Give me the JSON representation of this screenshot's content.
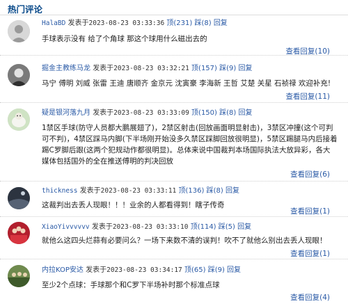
{
  "header": {
    "title": "热门评论"
  },
  "labels": {
    "posted": "发表于",
    "up": "顶",
    "down": "踩",
    "reply": "回复"
  },
  "comments": [
    {
      "user": "HalaBD",
      "time": "2023-08-23 03:33:36",
      "up": "(231)",
      "down": "(8)",
      "text": "手球表示没有 给了个角球 那这个球用什么磁出去的",
      "more": "查看回复(10)",
      "avatar_icon": "user-avatar-grey"
    },
    {
      "user": "掘金主教练马龙",
      "time": "2023-08-23 03:32:21",
      "up": "(157)",
      "down": "(9)",
      "text": "马宁 傅明 刘威 张雷 王迪 唐顺齐 金京元 沈寅豪 李海新 王哲 艾楚 关星 石祯禄 欢迎补充!",
      "more": "查看回复(11)",
      "avatar_icon": "user-avatar-photo"
    },
    {
      "user": "疑是银河落九月",
      "time": "2023-08-23 03:33:09",
      "up": "(150)",
      "down": "(8)",
      "text": "1禁区手球(防守人员都大鹏展翅了)，2禁区射击(回放画面明显射击)，3禁区冲撞(这个可判可不判)，4禁区踩马内脚(下半场刚开始没多久禁区踩脚回放很明显)，5禁区踢腿马内后接着踢C罗脚后跟(这两个犯规动作都很明显)。总体来说中国裁判本场国际执法大放异彩，各大媒体包括国外的全在推送傅明的判决回放",
      "more": "查看回复(6)",
      "avatar_icon": "user-avatar-sheep"
    },
    {
      "user": "thickness",
      "time": "2023-08-23 03:33:11",
      "up": "(136)",
      "down": "(8)",
      "text": "这裁判出去丢人现眼！！！业余的人都看得到！瞎子传奇",
      "more": "查看回复(1)",
      "avatar_icon": "user-avatar-dark"
    },
    {
      "user": "XiaoYivvvvvv",
      "time": "2023-08-23 03:33:10",
      "up": "(114)",
      "down": "(5)",
      "text": "就他么这四头烂蒜有必要问么？一场下来数不清的误判！吹不了就他么别出去丢人现眼！",
      "more": "查看回复(1)",
      "avatar_icon": "user-avatar-team"
    },
    {
      "user": "内拉KOP安达",
      "time": "2023-08-23 03:34:17",
      "up": "(65)",
      "down": "(9)",
      "text": "至少2个点球：手球那个和C罗下半场补时那个标准点球",
      "more": "查看回复(4)",
      "avatar_icon": "user-avatar-crowd"
    }
  ]
}
